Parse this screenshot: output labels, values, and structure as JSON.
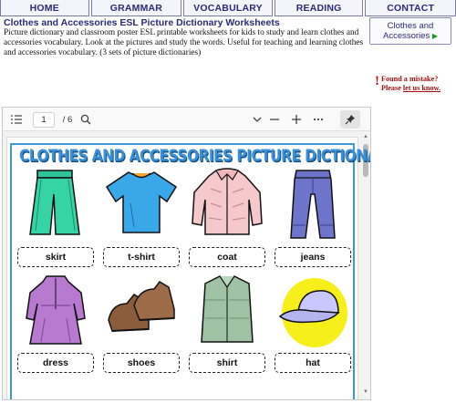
{
  "nav": {
    "home": "HOME",
    "grammar": "GRAMMAR",
    "vocabulary": "VOCABULARY",
    "reading": "READING",
    "contact": "CONTACT"
  },
  "page_title": "Clothes and Accessories ESL Picture Dictionary Worksheets",
  "description": "Picture dictionary and classroom poster ESL printable worksheets for kids to study and learn clothes and accessories vocabulary. Look at the pictures and study the words. Useful for teaching and learning clothes and accessories vocabulary. (3 sets of picture dictionaries)",
  "category_button": {
    "line1": "Clothes and",
    "line2": "Accessories",
    "arrow": "▶"
  },
  "mistake": {
    "bang": "!",
    "line1": "Found a mistake?",
    "please": "Please ",
    "link": "let us know."
  },
  "viewer": {
    "current_page": "1",
    "total_pages": "/ 6",
    "icons": [
      "outline-icon",
      "search-icon",
      "chevron-down-icon",
      "zoom-out-icon",
      "zoom-in-icon",
      "more-icon",
      "pin-icon"
    ]
  },
  "worksheet": {
    "title": "CLOTHES AND ACCESSORIES PICTURE DICTIONARY",
    "title_mark": "!",
    "items": [
      "skirt",
      "t-shirt",
      "coat",
      "jeans",
      "dress",
      "shoes",
      "shirt",
      "hat"
    ]
  },
  "colors": {
    "nav_text": "#2b2b7a",
    "sheet_border": "#3c9ad6",
    "title_blue": "#3a8fd8",
    "mistake_red": "#a01010"
  }
}
